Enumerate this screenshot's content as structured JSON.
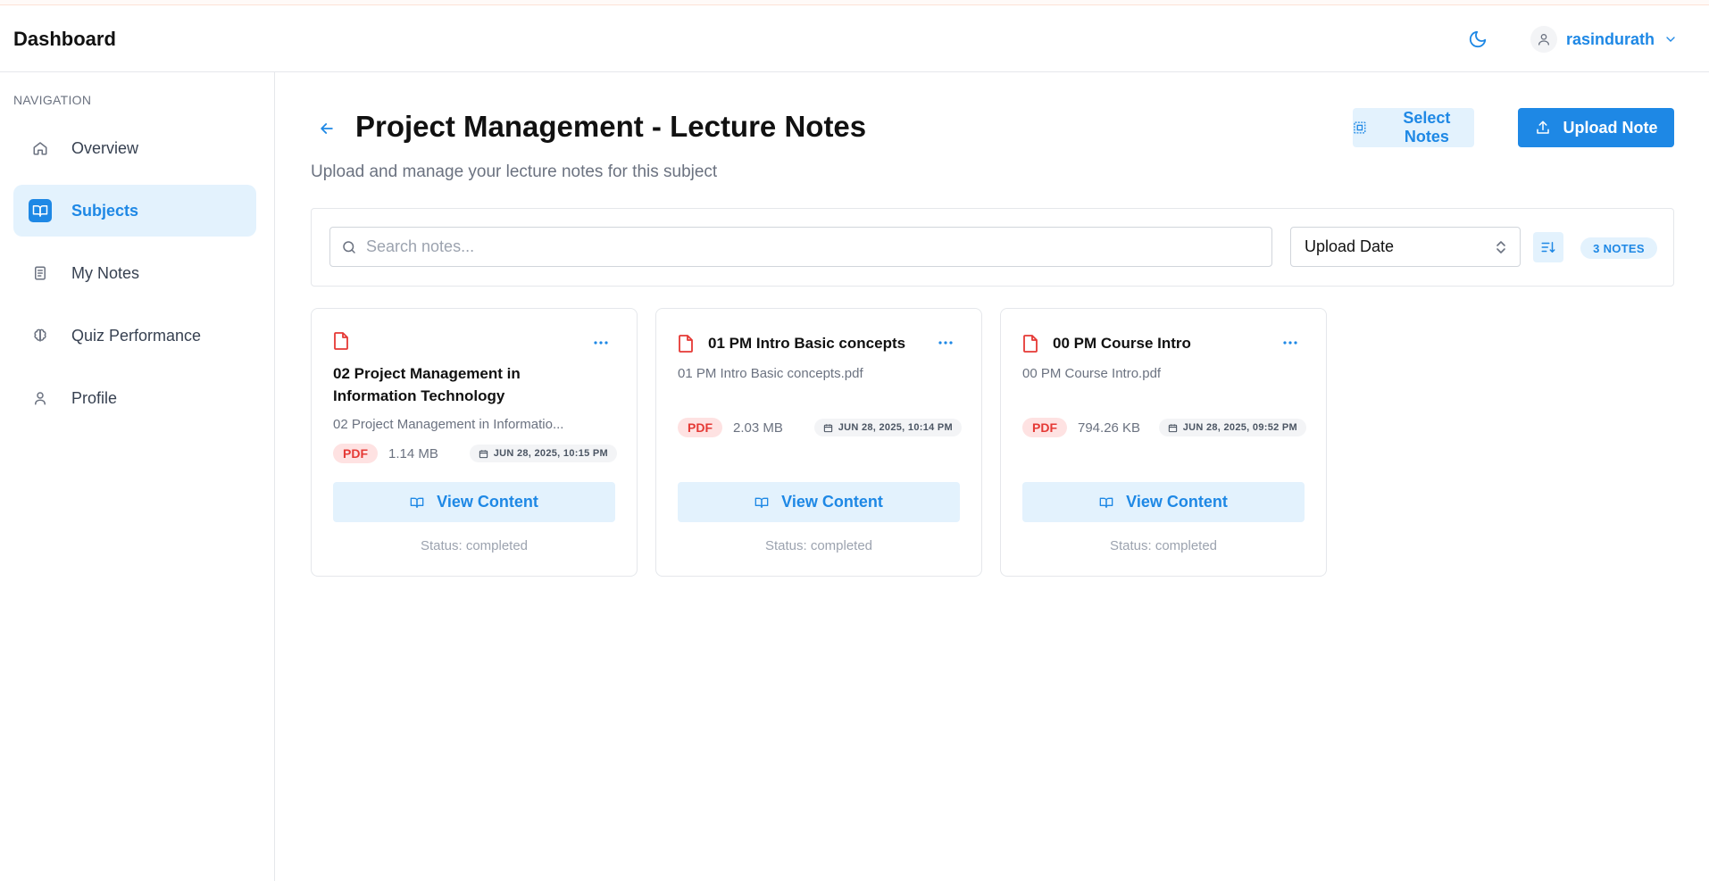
{
  "header": {
    "title": "Dashboard",
    "username": "rasindurath",
    "icons": {
      "theme": "moon-icon",
      "avatar": "user-icon",
      "dropdown": "chevron-down-icon"
    }
  },
  "sidebar": {
    "heading": "NAVIGATION",
    "items": [
      {
        "label": "Overview",
        "icon": "home-icon",
        "active": false
      },
      {
        "label": "Subjects",
        "icon": "book-open-icon",
        "active": true
      },
      {
        "label": "My Notes",
        "icon": "notes-icon",
        "active": false
      },
      {
        "label": "Quiz Performance",
        "icon": "brain-icon",
        "active": false
      },
      {
        "label": "Profile",
        "icon": "user-icon",
        "active": false
      }
    ]
  },
  "page": {
    "title": "Project Management - Lecture Notes",
    "subtitle": "Upload and manage your lecture notes for this subject",
    "select_label": "Select Notes",
    "upload_label": "Upload Note"
  },
  "filters": {
    "search_placeholder": "Search notes...",
    "sort_value": "Upload Date",
    "count": "3 NOTES"
  },
  "notes": [
    {
      "title": "02 Project Management in Information Technology",
      "filename": "02 Project Management in Informatio...",
      "type": "PDF",
      "size": "1.14 MB",
      "date": "JUN 28, 2025, 10:15 PM",
      "view_label": "View Content",
      "status": "Status: completed"
    },
    {
      "title": "01 PM Intro Basic concepts",
      "filename": "01 PM Intro Basic concepts.pdf",
      "type": "PDF",
      "size": "2.03 MB",
      "date": "JUN 28, 2025, 10:14 PM",
      "view_label": "View Content",
      "status": "Status: completed"
    },
    {
      "title": "00 PM Course Intro",
      "filename": "00 PM Course Intro.pdf",
      "type": "PDF",
      "size": "794.26 KB",
      "date": "JUN 28, 2025, 09:52 PM",
      "view_label": "View Content",
      "status": "Status: completed"
    }
  ],
  "colors": {
    "accent": "#1e88e5",
    "accent_light": "#e3f2fd",
    "pdf_red": "#e53935",
    "pdf_bg": "#fee2e2",
    "muted": "#6b7280",
    "border": "#e5e7eb"
  }
}
